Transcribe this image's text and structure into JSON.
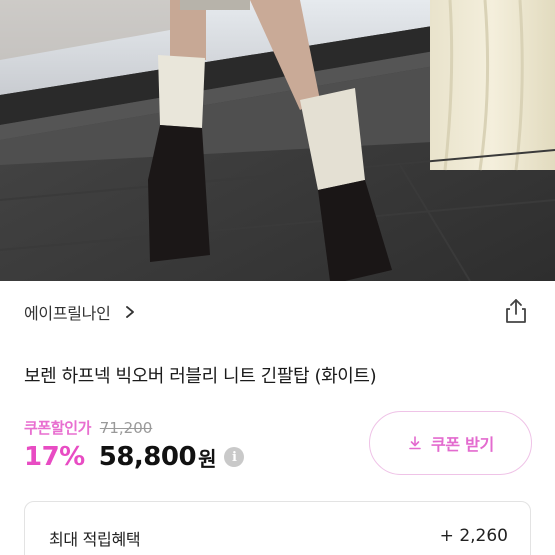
{
  "brand": {
    "name": "에이프릴나인"
  },
  "product": {
    "title": "보렌 하프넥 빅오버 러블리 니트 긴팔탑 (화이트)"
  },
  "pricing": {
    "coupon_label": "쿠폰할인가",
    "original_price": "71,200",
    "discount_percent": "17%",
    "sale_price": "58,800",
    "currency": "원",
    "info_icon_glyph": "i",
    "coupon_button_label": "쿠폰 받기",
    "accent_color": "#e84cc3"
  },
  "points": {
    "label": "최대 적립혜택",
    "value": "+ 2,260"
  },
  "icons": {
    "brand_chevron": "chevron-right-icon",
    "share": "share-icon",
    "coupon_download": "download-icon",
    "price_info": "info-icon"
  }
}
